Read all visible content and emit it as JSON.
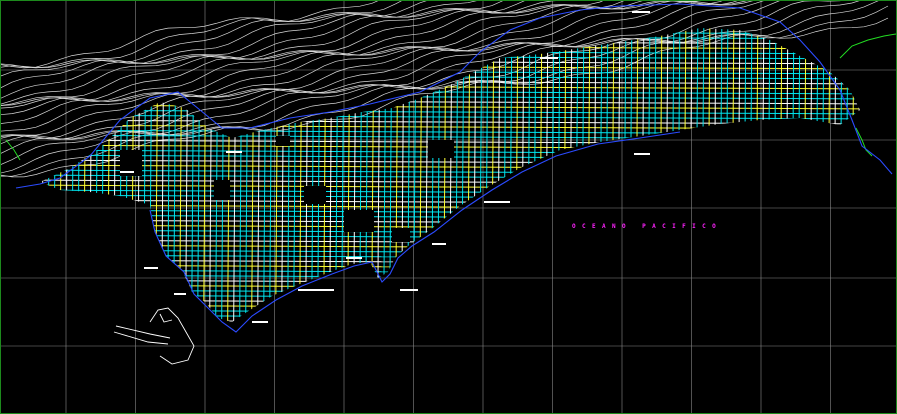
{
  "map": {
    "ocean_label": "OCEANO PACIFICO",
    "colors": {
      "background": "#000000",
      "grid": "#8a8a8a",
      "contour": "#d8d8d8",
      "coastline": "#2b4bff",
      "street_cyan": "#00e5ee",
      "street_yellow": "#ffff33",
      "street_white": "#ffffff",
      "vegetation": "#22dd22",
      "label": "#ff22ff",
      "frame": "#1d8a1d"
    }
  }
}
